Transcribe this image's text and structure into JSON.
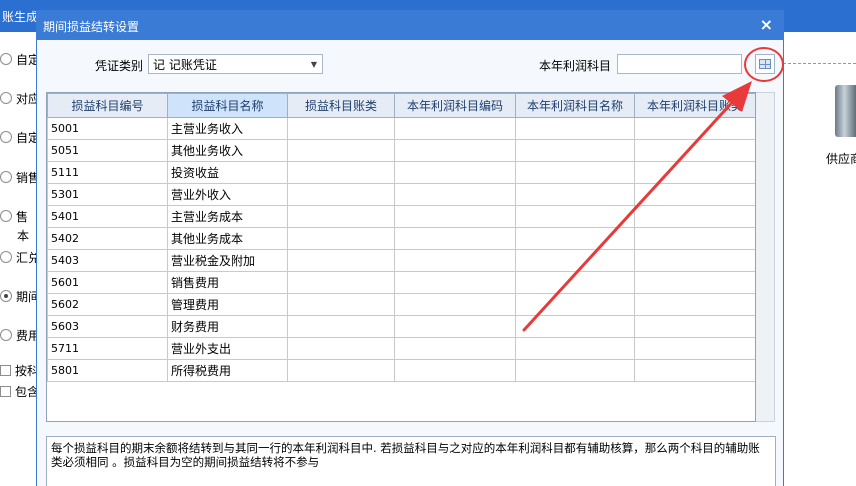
{
  "background": {
    "title_fragment": "账生成",
    "left_options": [
      {
        "label": "自定",
        "type": "radio",
        "checked": false
      },
      {
        "label": "对应",
        "type": "radio",
        "checked": false
      },
      {
        "label": "自定",
        "type": "radio",
        "checked": false
      },
      {
        "label": "销售",
        "type": "radio",
        "checked": false
      },
      {
        "label": "售",
        "type": "radio",
        "checked": false
      },
      {
        "label": "本",
        "type": "text",
        "checked": false
      },
      {
        "label": "汇兑",
        "type": "radio",
        "checked": false
      },
      {
        "label": "期间",
        "type": "radio",
        "checked": true
      },
      {
        "label": "费用",
        "type": "radio",
        "checked": false
      },
      {
        "label": "按科",
        "type": "checkbox",
        "checked": false
      },
      {
        "label": "包含",
        "type": "checkbox",
        "checked": false
      }
    ],
    "right_label": "供应商"
  },
  "dialog": {
    "title": "期间损益结转设置",
    "close": "×",
    "voucher_type_label": "凭证类别",
    "voucher_type_value": "记  记账凭证",
    "profit_account_label": "本年利润科目",
    "profit_account_value": "",
    "columns": [
      "损益科目编号",
      "损益科目名称",
      "损益科目账类",
      "本年利润科目编码",
      "本年利润科目名称",
      "本年利润科目账类"
    ],
    "rows": [
      {
        "code": "5001",
        "name": "主营业务收入"
      },
      {
        "code": "5051",
        "name": "其他业务收入"
      },
      {
        "code": "5111",
        "name": "投资收益"
      },
      {
        "code": "5301",
        "name": "营业外收入"
      },
      {
        "code": "5401",
        "name": "主营业务成本"
      },
      {
        "code": "5402",
        "name": "其他业务成本"
      },
      {
        "code": "5403",
        "name": "营业税金及附加"
      },
      {
        "code": "5601",
        "name": "销售费用"
      },
      {
        "code": "5602",
        "name": "管理费用"
      },
      {
        "code": "5603",
        "name": "财务费用"
      },
      {
        "code": "5711",
        "name": "营业外支出"
      },
      {
        "code": "5801",
        "name": "所得税费用"
      }
    ],
    "note": "每个损益科目的期末余额将结转到与其同一行的本年利润科目中. 若损益科目与之对应的本年利润科目都有辅助核算，那么两个科目的辅助账类必须相同   。损益科目为空的期间损益结转将不参与"
  },
  "colors": {
    "accent": "#3a7bd5",
    "annotation": "#e83a3a"
  }
}
